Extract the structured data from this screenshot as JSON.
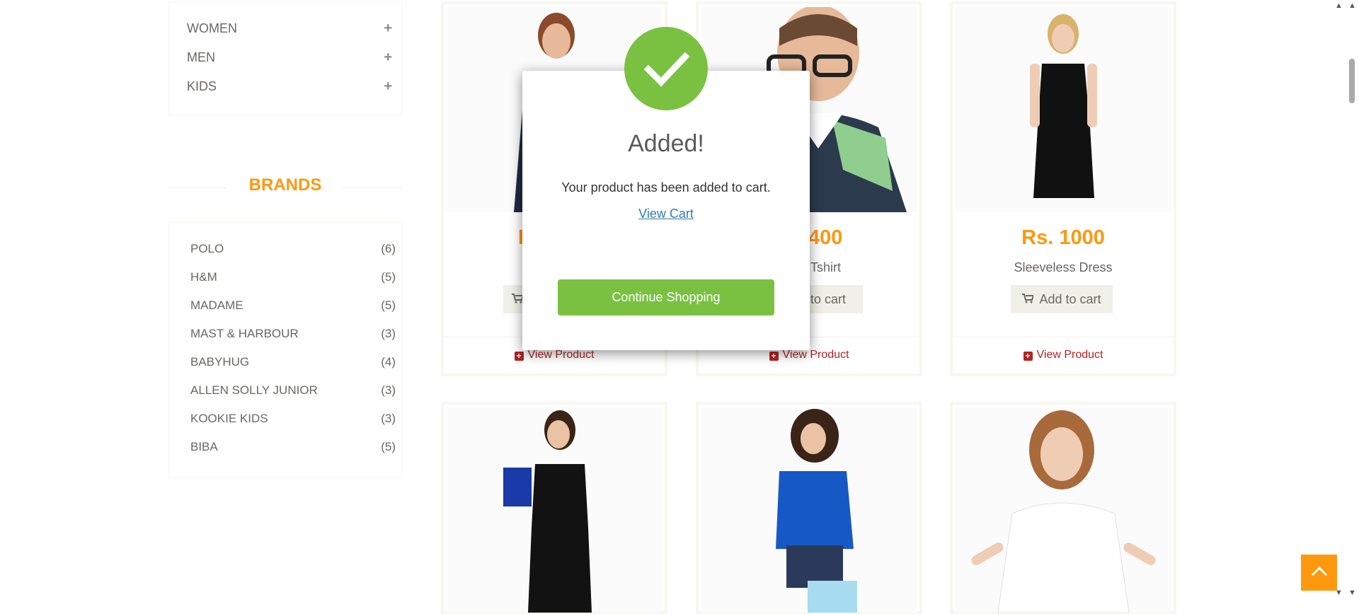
{
  "categories": [
    {
      "label": "WOMEN"
    },
    {
      "label": "MEN"
    },
    {
      "label": "KIDS"
    }
  ],
  "brands": {
    "title": "BRANDS",
    "items": [
      {
        "name": "POLO",
        "count": "(6)"
      },
      {
        "name": "H&M",
        "count": "(5)"
      },
      {
        "name": "MADAME",
        "count": "(5)"
      },
      {
        "name": "MAST & HARBOUR",
        "count": "(3)"
      },
      {
        "name": "BABYHUG",
        "count": "(4)"
      },
      {
        "name": "ALLEN SOLLY JUNIOR",
        "count": "(3)"
      },
      {
        "name": "KOOKIE KIDS",
        "count": "(3)"
      },
      {
        "name": "BIBA",
        "count": "(5)"
      }
    ]
  },
  "products": [
    {
      "price": "R",
      "name": "",
      "add_label": "",
      "view_label": "View Product"
    },
    {
      "price": "400",
      "name": "Tshirt",
      "add_label": "to cart",
      "view_label": "View Product"
    },
    {
      "price": "Rs. 1000",
      "name": "Sleeveless Dress",
      "add_label": "Add to cart",
      "view_label": "View Product"
    }
  ],
  "modal": {
    "title": "Added!",
    "message": "Your product has been added to cart.",
    "view_cart": "View Cart",
    "continue": "Continue Shopping"
  },
  "colors": {
    "accent": "#fe980f",
    "success": "#7ac142",
    "link": "#337ab7",
    "view_product": "#b22222"
  },
  "icons": {
    "category_toggle": "plus-icon",
    "add_to_cart": "cart-icon",
    "view_product": "plus-square-icon",
    "modal_status": "checkmark-icon",
    "back_to_top": "chevron-up-icon"
  }
}
